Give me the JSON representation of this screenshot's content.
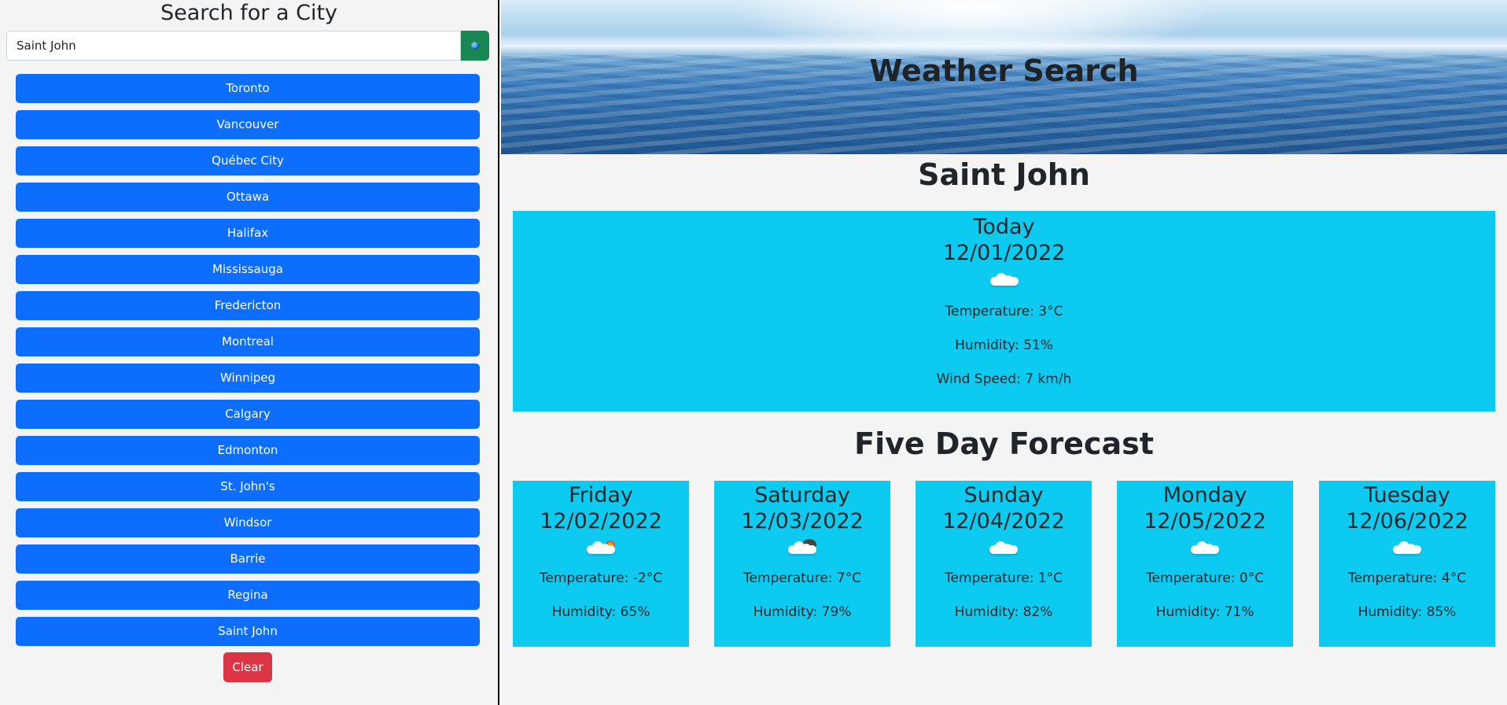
{
  "sidebar": {
    "title": "Search for a City",
    "search": {
      "value": "Saint John",
      "placeholder": ""
    },
    "search_button_icon": "globe-icon",
    "cities": [
      "Toronto",
      "Vancouver",
      "Québec City",
      "Ottawa",
      "Halifax",
      "Mississauga",
      "Fredericton",
      "Montreal",
      "Winnipeg",
      "Calgary",
      "Edmonton",
      "St. John's",
      "Windsor",
      "Barrie",
      "Regina",
      "Saint John"
    ],
    "clear_label": "Clear"
  },
  "header": {
    "title": "Weather Search"
  },
  "current": {
    "city": "Saint John",
    "day": "Today",
    "date": "12/01/2022",
    "icon": "cloud-icon",
    "temperature": "Temperature: 3°C",
    "humidity": "Humidity: 51%",
    "wind": "Wind Speed: 7 km/h"
  },
  "forecast": {
    "title": "Five Day Forecast",
    "days": [
      {
        "day": "Friday",
        "date": "12/02/2022",
        "icon": "sun-behind-cloud-icon",
        "temperature": "Temperature: -2°C",
        "humidity": "Humidity: 65%"
      },
      {
        "day": "Saturday",
        "date": "12/03/2022",
        "icon": "dark-cloud-icon",
        "temperature": "Temperature: 7°C",
        "humidity": "Humidity: 79%"
      },
      {
        "day": "Sunday",
        "date": "12/04/2022",
        "icon": "cloud-icon",
        "temperature": "Temperature: 1°C",
        "humidity": "Humidity: 82%"
      },
      {
        "day": "Monday",
        "date": "12/05/2022",
        "icon": "cloud-icon",
        "temperature": "Temperature: 0°C",
        "humidity": "Humidity: 71%"
      },
      {
        "day": "Tuesday",
        "date": "12/06/2022",
        "icon": "cloud-icon",
        "temperature": "Temperature: 4°C",
        "humidity": "Humidity: 85%"
      }
    ]
  },
  "colors": {
    "city_button": "#0d6efd",
    "search_button": "#198754",
    "clear_button": "#dc3545",
    "card_background": "#0dcaf0"
  }
}
